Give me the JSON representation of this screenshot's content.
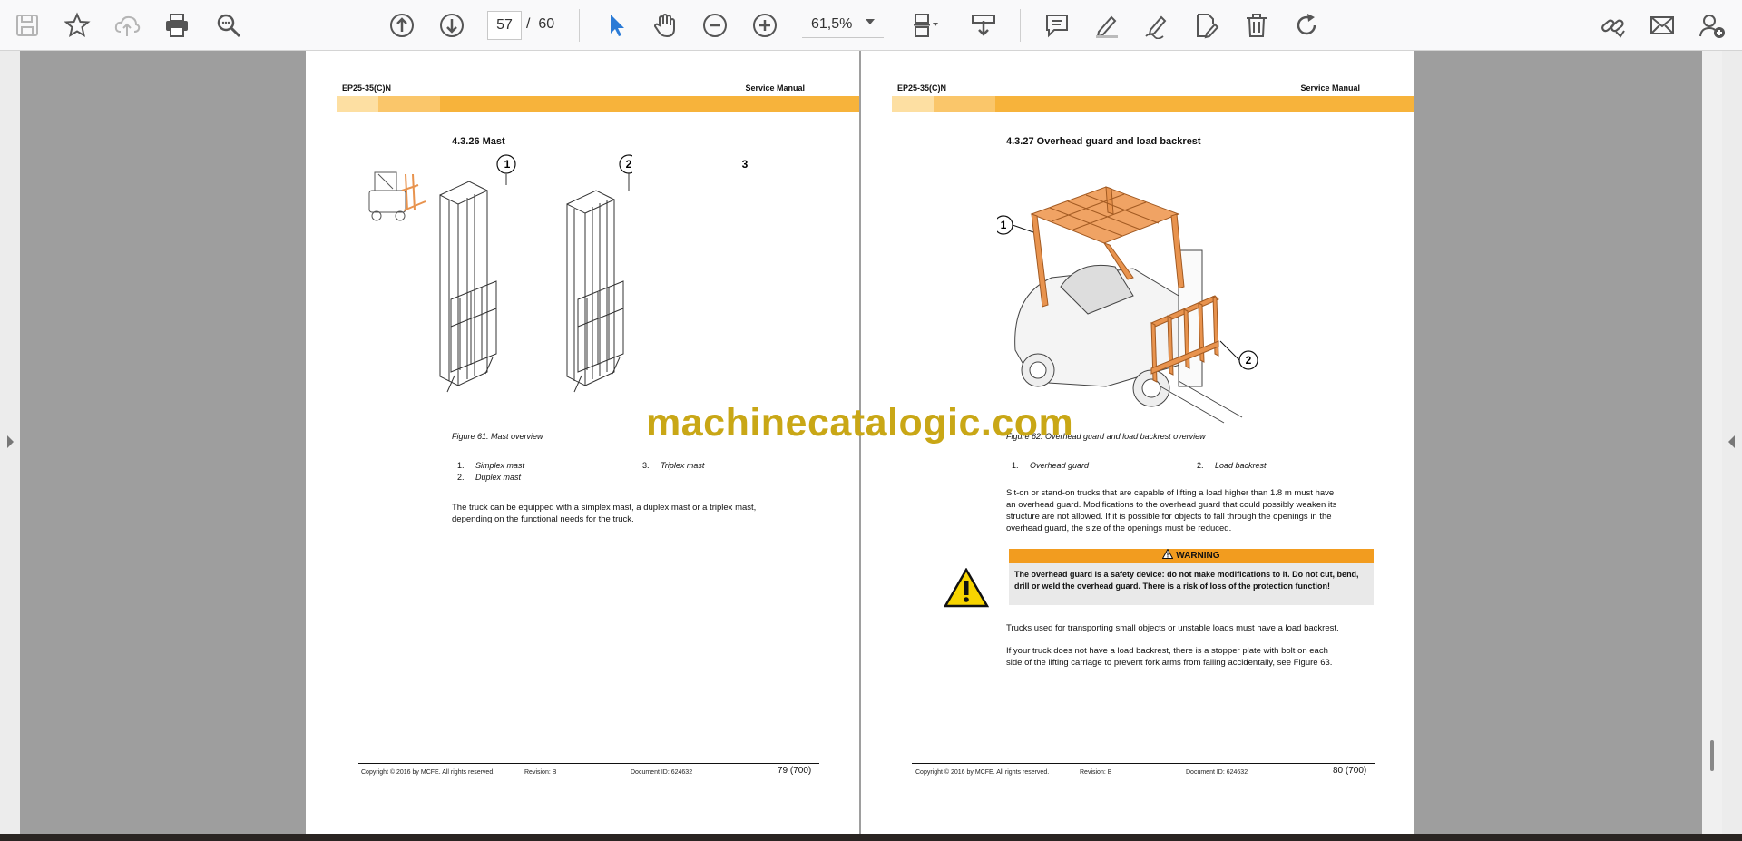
{
  "toolbar": {
    "page_current": "57",
    "page_separator": "/",
    "page_total": "60",
    "zoom": "61,5%",
    "icons": [
      "save-icon",
      "bookmark-star-icon",
      "cloud-upload-icon",
      "print-icon",
      "zoom-search-icon",
      "page-up-icon",
      "page-down-icon",
      "select-cursor-icon",
      "hand-tool-icon",
      "zoom-out-icon",
      "zoom-in-icon",
      "fit-page-icon",
      "download-icon",
      "comment-icon",
      "highlight-pen-icon",
      "signature-icon",
      "edit-document-icon",
      "delete-icon",
      "rotate-icon",
      "share-link-icon",
      "email-icon",
      "add-user-icon"
    ]
  },
  "colors": {
    "band": "#f7b33b",
    "warning": "#f29c1f",
    "watermark": "#c9a716",
    "figure_accent": "#e8934e"
  },
  "left_page": {
    "header_left": "EP25-35(C)N",
    "header_right": "Service Manual",
    "section": "4.3.26    Mast",
    "callouts": [
      "1",
      "2",
      "3"
    ],
    "caption": "Figure 61. Mast overview",
    "legend": [
      {
        "n": "1.",
        "label": "Simplex mast"
      },
      {
        "n": "2.",
        "label": "Duplex mast"
      },
      {
        "n": "3.",
        "label": "Triplex mast"
      }
    ],
    "paragraph_lines": [
      "The truck can be equipped with a simplex mast, a duplex mast or a triplex mast,",
      "depending on the functional needs for the truck."
    ],
    "footer": {
      "copyright": "Copyright © 2016 by MCFE. All rights reserved.",
      "revision": "Revision: B",
      "document": "Document ID: 624632",
      "page": "79 (700)"
    }
  },
  "right_page": {
    "header_left": "EP25-35(C)N",
    "header_right": "Service Manual",
    "section": "4.3.27    Overhead guard and load backrest",
    "callouts": [
      "1",
      "2"
    ],
    "caption": "Figure 62. Overhead guard and load backrest overview",
    "legend": [
      {
        "n": "1.",
        "label": "Overhead guard"
      },
      {
        "n": "2.",
        "label": "Load backrest"
      }
    ],
    "paragraph1_lines": [
      "Sit-on or stand-on trucks that are capable of lifting a load higher than 1.8 m must have",
      "an overhead guard. Modifications to the overhead guard that could possibly weaken its",
      "structure are not allowed. If it is possible for objects to fall through the openings in the",
      "overhead guard, the size of the openings must be reduced."
    ],
    "warning_title": "WARNING",
    "warning_lines": [
      "The overhead guard is a safety device: do not make modifications to it. Do not cut, bend,",
      "drill or weld the overhead guard. There is a risk of loss of the protection function!"
    ],
    "paragraph2": "Trucks used for transporting small objects or unstable loads must have a load backrest.",
    "paragraph3_lines": [
      "If your truck does not have a load backrest, there is a stopper plate with bolt on each",
      "side of the lifting carriage to prevent fork arms from falling accidentally, see Figure 63."
    ],
    "footer": {
      "copyright": "Copyright © 2016 by MCFE. All rights reserved.",
      "revision": "Revision: B",
      "document": "Document ID: 624632",
      "page": "80 (700)"
    }
  },
  "watermark": "machinecatalogic.com"
}
